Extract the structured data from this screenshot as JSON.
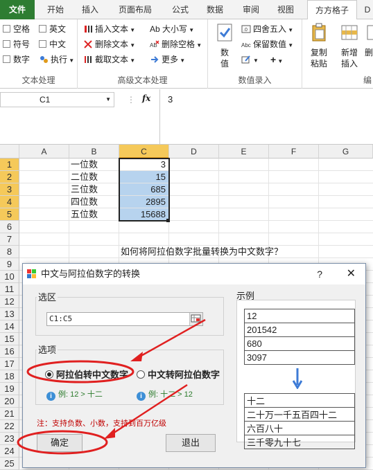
{
  "tabs": [
    "文件",
    "开始",
    "插入",
    "页面布局",
    "公式",
    "数据",
    "审阅",
    "视图",
    "方方格子",
    "D"
  ],
  "ribbon": {
    "text_group": {
      "items": [
        "空格",
        "英文",
        "符号",
        "中文",
        "数字",
        "执行"
      ],
      "label": "文本处理"
    },
    "adv_group": {
      "items": [
        "插入文本",
        "Ab 大小写",
        "删除文本",
        "删除空格",
        "截取文本",
        "更多"
      ],
      "label": "高级文本处理"
    },
    "num_group": {
      "big": "数值",
      "items": [
        "四舍五入",
        "保留数值"
      ],
      "label": "数值录入"
    },
    "edit_group": {
      "items": [
        "复制粘贴",
        "新增插入",
        "删"
      ],
      "label": "编"
    }
  },
  "formula_bar": {
    "name_box": "C1",
    "fx": "fx",
    "value": "3"
  },
  "grid": {
    "columns": [
      "A",
      "B",
      "C",
      "D",
      "E",
      "F",
      "G"
    ],
    "rows": [
      "1",
      "2",
      "3",
      "4",
      "5",
      "6",
      "7",
      "8",
      "9",
      "10",
      "11",
      "12",
      "13",
      "14",
      "15",
      "16",
      "17",
      "18",
      "19",
      "20",
      "21",
      "22",
      "23",
      "24",
      "25"
    ],
    "b_values": [
      "一位数",
      "二位数",
      "三位数",
      "四位数",
      "五位数"
    ],
    "c_values": [
      "3",
      "15",
      "685",
      "2895",
      "15688"
    ],
    "row8_title": "如何将阿拉伯数字批量转换为中文数字？"
  },
  "dialog": {
    "title": "中文与阿拉伯数字的转换",
    "help": "?",
    "close": "✕",
    "range_label": "选区",
    "range_value": "C1:C5",
    "option_label": "选项",
    "option1": "阿拉伯转中文数字",
    "option2": "中文转阿拉伯数字",
    "example1": "例: 12 > 十二",
    "example2": "例: 十二 > 12",
    "note": "注：支持负数、小数，支持到百万亿级",
    "ok": "确定",
    "exit": "退出",
    "example_label": "示例",
    "example_in": [
      "12",
      "201542",
      "680",
      "3097"
    ],
    "example_out": [
      "十二",
      "二十万一千五百四十二",
      "六百八十",
      "三千零九十七"
    ]
  },
  "colors": {
    "file_tab": "#2e7d32",
    "selection": "#b7d3ee",
    "header_sel": "#f5c95a",
    "annotation": "#e02020"
  }
}
